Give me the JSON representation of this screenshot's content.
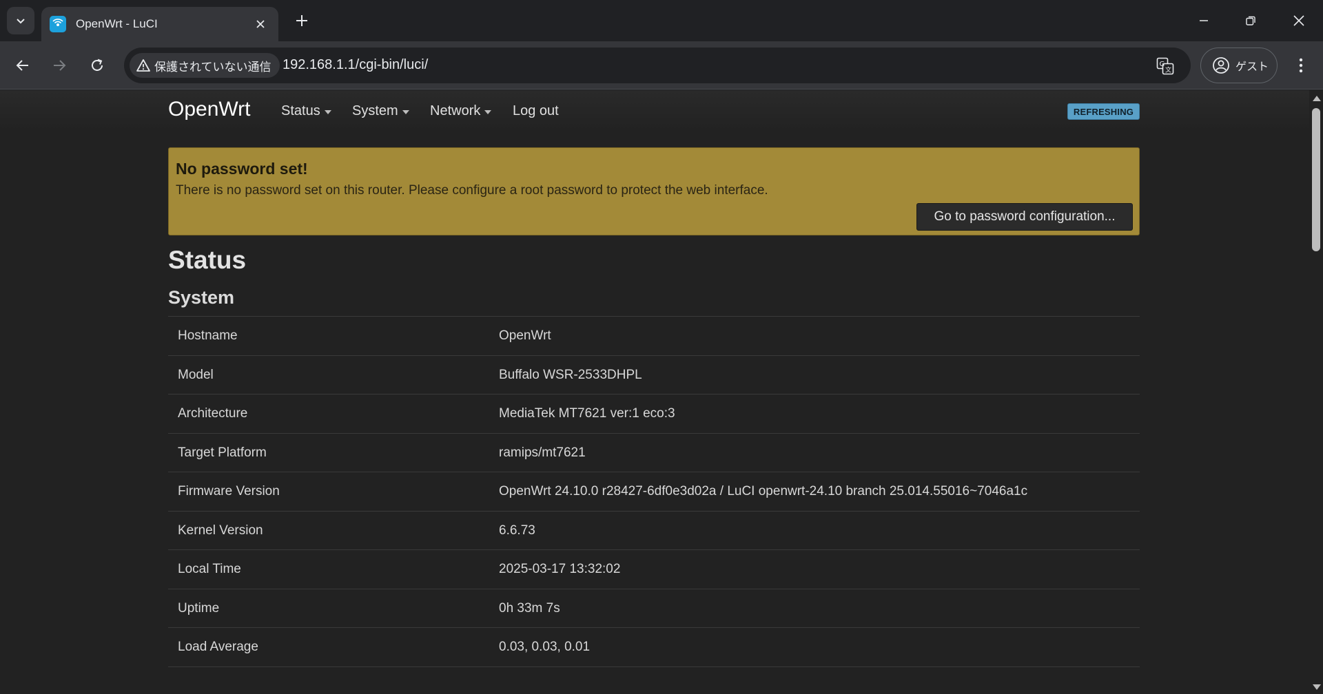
{
  "browser": {
    "tab_title": "OpenWrt - LuCI",
    "security_label": "保護されていない通信",
    "url": "192.168.1.1/cgi-bin/luci/",
    "profile_label": "ゲスト"
  },
  "navbar": {
    "brand": "OpenWrt",
    "items": [
      {
        "label": "Status",
        "dropdown": true
      },
      {
        "label": "System",
        "dropdown": true
      },
      {
        "label": "Network",
        "dropdown": true
      },
      {
        "label": "Log out",
        "dropdown": false
      }
    ],
    "badge": "REFRESHING"
  },
  "alert": {
    "title": "No password set!",
    "message": "There is no password set on this router. Please configure a root password to protect the web interface.",
    "button_label": "Go to password configuration..."
  },
  "main": {
    "title": "Status",
    "section_title": "System",
    "rows": [
      {
        "key": "Hostname",
        "value": "OpenWrt"
      },
      {
        "key": "Model",
        "value": "Buffalo WSR-2533DHPL"
      },
      {
        "key": "Architecture",
        "value": "MediaTek MT7621 ver:1 eco:3"
      },
      {
        "key": "Target Platform",
        "value": "ramips/mt7621"
      },
      {
        "key": "Firmware Version",
        "value": "OpenWrt 24.10.0 r28427-6df0e3d02a / LuCI openwrt-24.10 branch 25.014.55016~7046a1c"
      },
      {
        "key": "Kernel Version",
        "value": "6.6.73"
      },
      {
        "key": "Local Time",
        "value": "2025-03-17 13:32:02"
      },
      {
        "key": "Uptime",
        "value": "0h 33m 7s"
      },
      {
        "key": "Load Average",
        "value": "0.03, 0.03, 0.01"
      }
    ]
  },
  "colors": {
    "alert_bg": "#a38a38",
    "badge_bg": "#59a0c7",
    "page_bg": "#222222"
  }
}
